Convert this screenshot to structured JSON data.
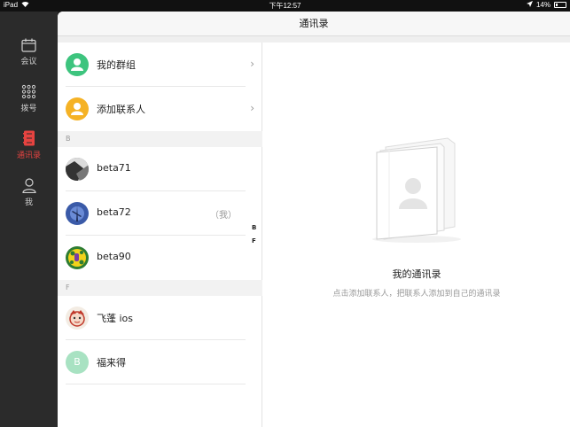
{
  "status_bar": {
    "device": "iPad",
    "time": "下午12:57",
    "battery": "14%"
  },
  "sidebar": {
    "items": [
      {
        "label": "会议",
        "icon": "calendar-icon",
        "active": false
      },
      {
        "label": "拨号",
        "icon": "dialpad-icon",
        "active": false
      },
      {
        "label": "通讯录",
        "icon": "contacts-book-icon",
        "active": true
      },
      {
        "label": "我",
        "icon": "person-icon",
        "active": false
      }
    ]
  },
  "header": {
    "title": "通讯录"
  },
  "list": {
    "top_items": [
      {
        "label": "我的群组",
        "icon": "group-icon",
        "color": "#3dc47e"
      },
      {
        "label": "添加联系人",
        "icon": "add-contact-icon",
        "color": "#f5b225"
      }
    ],
    "sections": [
      {
        "letter": "B",
        "contacts": [
          {
            "name": "beta71",
            "me": ""
          },
          {
            "name": "beta72",
            "me": "（我）"
          },
          {
            "name": "beta90",
            "me": ""
          }
        ]
      },
      {
        "letter": "F",
        "contacts": [
          {
            "name": "飞蓬 ios",
            "me": ""
          },
          {
            "name": "福来得",
            "me": "",
            "initial": "B"
          }
        ]
      }
    ],
    "index_letters": [
      "B",
      "F"
    ]
  },
  "empty_state": {
    "title": "我的通讯录",
    "subtitle": "点击添加联系人，把联系人添加到自己的通讯录"
  },
  "colors": {
    "accent": "#e64340",
    "sidebar_bg": "#2b2b2b"
  }
}
